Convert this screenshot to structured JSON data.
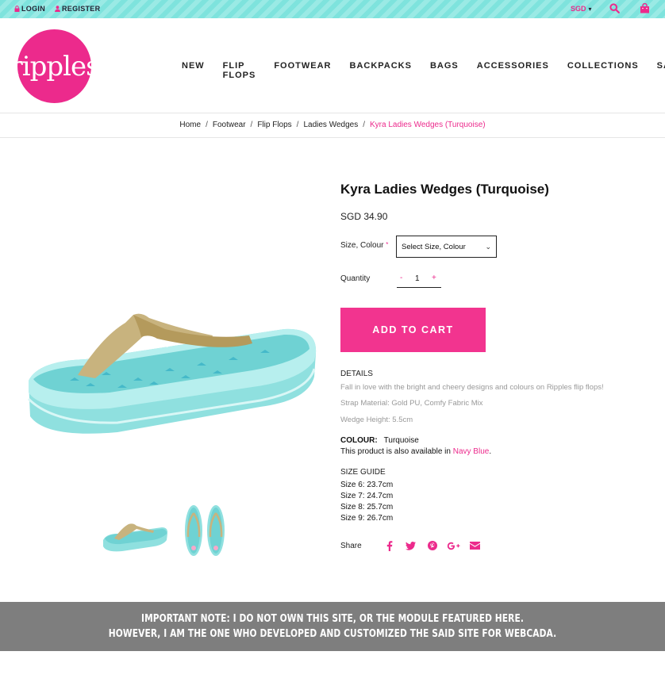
{
  "topbar": {
    "login": "LOGIN",
    "register": "REGISTER",
    "currency": "SGD",
    "icons": [
      "lock-icon",
      "user-icon",
      "search-icon",
      "shopping-bag-icon"
    ]
  },
  "brand": {
    "logo_text": "ripples",
    "color": "#ec2a8c"
  },
  "nav": [
    "NEW",
    "FLIP FLOPS",
    "FOOTWEAR",
    "BACKPACKS",
    "BAGS",
    "ACCESSORIES",
    "COLLECTIONS",
    "SALE"
  ],
  "breadcrumb": [
    "Home",
    "Footwear",
    "Flip Flops",
    "Ladies Wedges",
    "Kyra Ladies Wedges (Turquoise)"
  ],
  "product": {
    "title": "Kyra Ladies Wedges (Turquoise)",
    "price": "SGD 34.90",
    "size_label": "Size, Colour",
    "required_mark": "*",
    "select_value": "Select Size, Colour",
    "qty_label": "Quantity",
    "qty_minus": "-",
    "qty_value": "1",
    "qty_plus": "+",
    "add_to_cart": "ADD TO CART"
  },
  "details": {
    "heading": "DETAILS",
    "lines": [
      "Fall in love with the bright and cheery designs and colours on Ripples flip flops!",
      "Strap Material: Gold PU, Comfy Fabric Mix",
      "Wedge Height: 5.5cm"
    ],
    "colour_label": "COLOUR:",
    "colour_value": "Turquoise",
    "avail_prefix": "This product is also available in ",
    "avail_link": "Navy Blue",
    "avail_suffix": "."
  },
  "size_guide": {
    "heading": "SIZE GUIDE",
    "rows": [
      "Size 6: 23.7cm",
      "Size 7: 24.7cm",
      "Size 8: 25.7cm",
      "Size 9: 26.7cm"
    ]
  },
  "share": {
    "label": "Share",
    "icons": [
      "facebook-icon",
      "twitter-icon",
      "pinterest-icon",
      "google-plus-icon",
      "email-icon"
    ]
  },
  "note": {
    "line1": "IMPORTANT NOTE:  I  DO NOT OWN THIS SITE, OR THE  MODULE  FEATURED  HERE.",
    "line2": "HOWEVER, I AM THE ONE WHO DEVELOPED AND CUSTOMIZED THE SAID SITE FOR WEBCADA."
  },
  "colors": {
    "accent": "#ec2a8c",
    "topbar": "#8fe7e1",
    "note_band": "#7e7e7e"
  }
}
